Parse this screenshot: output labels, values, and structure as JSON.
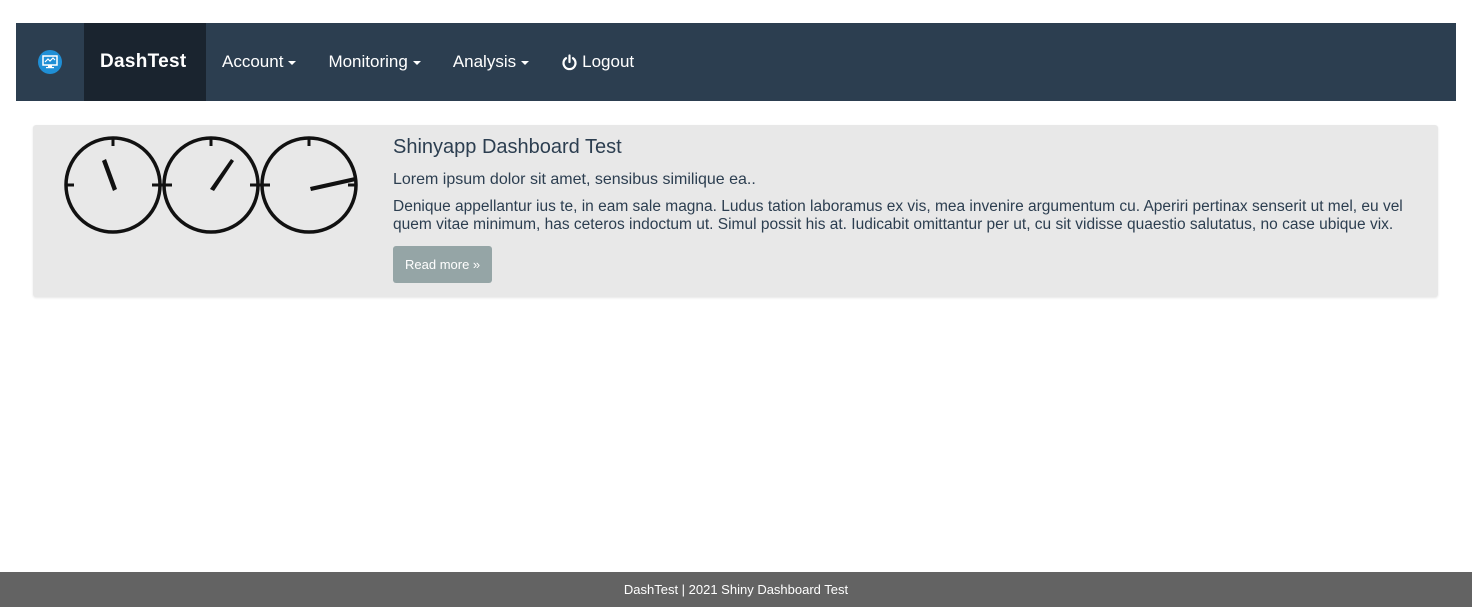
{
  "navbar": {
    "brand": "DashTest",
    "logo_icon": "monitor-logo-icon",
    "items": [
      {
        "label": "Account",
        "dropdown": true
      },
      {
        "label": "Monitoring",
        "dropdown": true
      },
      {
        "label": "Analysis",
        "dropdown": true
      }
    ],
    "logout": {
      "label": "Logout",
      "icon": "power-icon"
    },
    "colors": {
      "background": "#2c3e50",
      "brand_background": "#1a242f"
    }
  },
  "hero": {
    "image_icon": "gauges-icon",
    "title": "Shinyapp Dashboard Test",
    "lead": "Lorem ipsum dolor sit amet, sensibus similique ea..",
    "body": "Denique appellantur ius te, in eam sale magna. Ludus tation laboramus ex vis, mea invenire argumentum cu. Aperiri pertinax senserit ut mel, eu vel quem vitae minimum, has ceteros indoctum ut. Simul possit his at. Iudicabit omittantur per ut, cu sit vidisse quaestio salutatus, no case ubique vix.",
    "button_label": "Read more »",
    "colors": {
      "background": "#e8e8e8",
      "button": "#95a5a6"
    }
  },
  "footer": {
    "text": "DashTest | 2021 Shiny Dashboard Test",
    "color": "#636363"
  }
}
